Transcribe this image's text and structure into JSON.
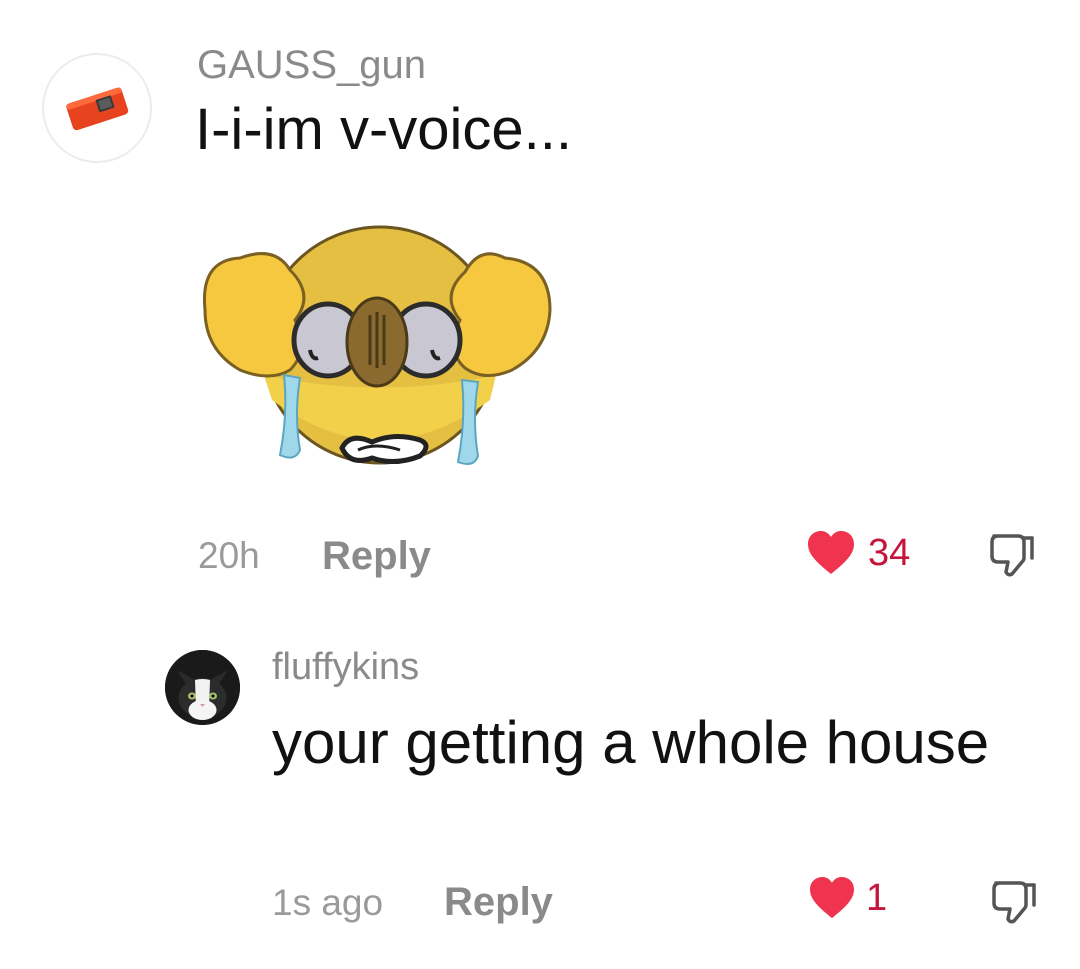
{
  "comments": [
    {
      "username": "GAUSS_gun",
      "text": "I-i-im v-voice...",
      "time": "20h",
      "reply_label": "Reply",
      "likes": "34",
      "liked": true,
      "avatar_icon": "orange-device-icon",
      "sticker": "crying-emoji-sticker"
    },
    {
      "username": "fluffykins",
      "text": "your getting a whole house",
      "time": "1s ago",
      "reply_label": "Reply",
      "likes": "1",
      "liked": true,
      "avatar_icon": "cat-avatar"
    }
  ],
  "colors": {
    "heart": "#f0334e",
    "like_count": "#c4163c",
    "username": "#8a8a8a",
    "meta": "#9a9a9a",
    "text": "#111111"
  }
}
